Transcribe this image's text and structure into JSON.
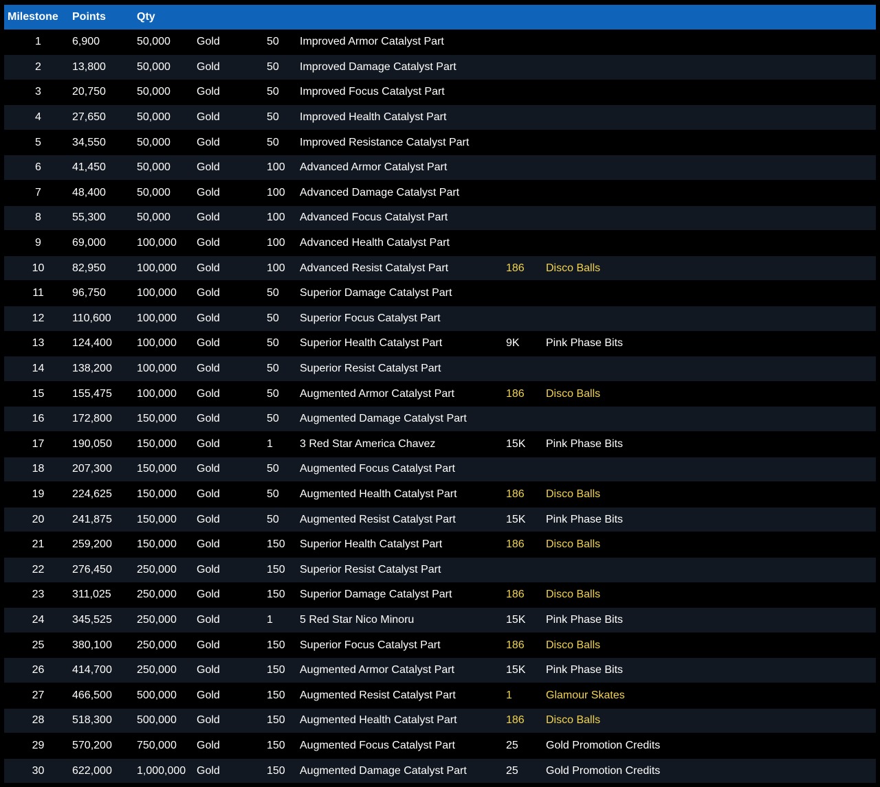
{
  "table": {
    "headers": [
      "Milestone",
      "Points",
      "Qty",
      "",
      "",
      "",
      "",
      ""
    ],
    "highlight_color": "#f2d44e",
    "header_color": "#0f63b8",
    "rows": [
      {
        "milestone": "1",
        "points": "6,900",
        "qty": "50,000",
        "currency": "Gold",
        "amount": "50",
        "reward": "Improved Armor Catalyst Part",
        "bonus_qty": "",
        "bonus_item": "",
        "highlight": false
      },
      {
        "milestone": "2",
        "points": "13,800",
        "qty": "50,000",
        "currency": "Gold",
        "amount": "50",
        "reward": "Improved Damage Catalyst Part",
        "bonus_qty": "",
        "bonus_item": "",
        "highlight": false
      },
      {
        "milestone": "3",
        "points": "20,750",
        "qty": "50,000",
        "currency": "Gold",
        "amount": "50",
        "reward": "Improved Focus Catalyst Part",
        "bonus_qty": "",
        "bonus_item": "",
        "highlight": false
      },
      {
        "milestone": "4",
        "points": "27,650",
        "qty": "50,000",
        "currency": "Gold",
        "amount": "50",
        "reward": "Improved Health Catalyst Part",
        "bonus_qty": "",
        "bonus_item": "",
        "highlight": false
      },
      {
        "milestone": "5",
        "points": "34,550",
        "qty": "50,000",
        "currency": "Gold",
        "amount": "50",
        "reward": "Improved Resistance Catalyst Part",
        "bonus_qty": "",
        "bonus_item": "",
        "highlight": false
      },
      {
        "milestone": "6",
        "points": "41,450",
        "qty": "50,000",
        "currency": "Gold",
        "amount": "100",
        "reward": "Advanced Armor Catalyst Part",
        "bonus_qty": "",
        "bonus_item": "",
        "highlight": false
      },
      {
        "milestone": "7",
        "points": "48,400",
        "qty": "50,000",
        "currency": "Gold",
        "amount": "100",
        "reward": "Advanced Damage Catalyst Part",
        "bonus_qty": "",
        "bonus_item": "",
        "highlight": false
      },
      {
        "milestone": "8",
        "points": "55,300",
        "qty": "50,000",
        "currency": "Gold",
        "amount": "100",
        "reward": "Advanced Focus Catalyst Part",
        "bonus_qty": "",
        "bonus_item": "",
        "highlight": false
      },
      {
        "milestone": "9",
        "points": "69,000",
        "qty": "100,000",
        "currency": "Gold",
        "amount": "100",
        "reward": "Advanced Health Catalyst Part",
        "bonus_qty": "",
        "bonus_item": "",
        "highlight": false
      },
      {
        "milestone": "10",
        "points": "82,950",
        "qty": "100,000",
        "currency": "Gold",
        "amount": "100",
        "reward": "Advanced Resist Catalyst Part",
        "bonus_qty": "186",
        "bonus_item": "Disco Balls",
        "highlight": true
      },
      {
        "milestone": "11",
        "points": "96,750",
        "qty": "100,000",
        "currency": "Gold",
        "amount": "50",
        "reward": "Superior Damage Catalyst Part",
        "bonus_qty": "",
        "bonus_item": "",
        "highlight": false
      },
      {
        "milestone": "12",
        "points": "110,600",
        "qty": "100,000",
        "currency": "Gold",
        "amount": "50",
        "reward": "Superior Focus Catalyst Part",
        "bonus_qty": "",
        "bonus_item": "",
        "highlight": false
      },
      {
        "milestone": "13",
        "points": "124,400",
        "qty": "100,000",
        "currency": "Gold",
        "amount": "50",
        "reward": "Superior Health Catalyst Part",
        "bonus_qty": "9K",
        "bonus_item": "Pink Phase Bits",
        "highlight": false
      },
      {
        "milestone": "14",
        "points": "138,200",
        "qty": "100,000",
        "currency": "Gold",
        "amount": "50",
        "reward": "Superior Resist Catalyst Part",
        "bonus_qty": "",
        "bonus_item": "",
        "highlight": false
      },
      {
        "milestone": "15",
        "points": "155,475",
        "qty": "100,000",
        "currency": "Gold",
        "amount": "50",
        "reward": "Augmented Armor Catalyst Part",
        "bonus_qty": "186",
        "bonus_item": "Disco Balls",
        "highlight": true
      },
      {
        "milestone": "16",
        "points": "172,800",
        "qty": "150,000",
        "currency": "Gold",
        "amount": "50",
        "reward": "Augmented Damage Catalyst Part",
        "bonus_qty": "",
        "bonus_item": "",
        "highlight": false
      },
      {
        "milestone": "17",
        "points": "190,050",
        "qty": "150,000",
        "currency": "Gold",
        "amount": "1",
        "reward": "3 Red Star America Chavez",
        "bonus_qty": "15K",
        "bonus_item": "Pink Phase Bits",
        "highlight": false
      },
      {
        "milestone": "18",
        "points": "207,300",
        "qty": "150,000",
        "currency": "Gold",
        "amount": "50",
        "reward": "Augmented Focus Catalyst Part",
        "bonus_qty": "",
        "bonus_item": "",
        "highlight": false
      },
      {
        "milestone": "19",
        "points": "224,625",
        "qty": "150,000",
        "currency": "Gold",
        "amount": "50",
        "reward": "Augmented Health Catalyst Part",
        "bonus_qty": "186",
        "bonus_item": "Disco Balls",
        "highlight": true
      },
      {
        "milestone": "20",
        "points": "241,875",
        "qty": "150,000",
        "currency": "Gold",
        "amount": "50",
        "reward": "Augmented Resist Catalyst Part",
        "bonus_qty": "15K",
        "bonus_item": "Pink Phase Bits",
        "highlight": false
      },
      {
        "milestone": "21",
        "points": "259,200",
        "qty": "150,000",
        "currency": "Gold",
        "amount": "150",
        "reward": "Superior Health Catalyst Part",
        "bonus_qty": "186",
        "bonus_item": "Disco Balls",
        "highlight": true
      },
      {
        "milestone": "22",
        "points": "276,450",
        "qty": "250,000",
        "currency": "Gold",
        "amount": "150",
        "reward": "Superior Resist Catalyst Part",
        "bonus_qty": "",
        "bonus_item": "",
        "highlight": false
      },
      {
        "milestone": "23",
        "points": "311,025",
        "qty": "250,000",
        "currency": "Gold",
        "amount": "150",
        "reward": "Superior Damage Catalyst Part",
        "bonus_qty": "186",
        "bonus_item": "Disco Balls",
        "highlight": true
      },
      {
        "milestone": "24",
        "points": "345,525",
        "qty": "250,000",
        "currency": "Gold",
        "amount": "1",
        "reward": "5 Red Star Nico Minoru",
        "bonus_qty": "15K",
        "bonus_item": "Pink Phase Bits",
        "highlight": false
      },
      {
        "milestone": "25",
        "points": "380,100",
        "qty": "250,000",
        "currency": "Gold",
        "amount": "150",
        "reward": "Superior Focus Catalyst Part",
        "bonus_qty": "186",
        "bonus_item": "Disco Balls",
        "highlight": true
      },
      {
        "milestone": "26",
        "points": "414,700",
        "qty": "250,000",
        "currency": "Gold",
        "amount": "150",
        "reward": "Augmented Armor Catalyst Part",
        "bonus_qty": "15K",
        "bonus_item": "Pink Phase Bits",
        "highlight": false
      },
      {
        "milestone": "27",
        "points": "466,500",
        "qty": "500,000",
        "currency": "Gold",
        "amount": "150",
        "reward": "Augmented Resist Catalyst Part",
        "bonus_qty": "1",
        "bonus_item": "Glamour Skates",
        "highlight": true
      },
      {
        "milestone": "28",
        "points": "518,300",
        "qty": "500,000",
        "currency": "Gold",
        "amount": "150",
        "reward": "Augmented Health Catalyst Part",
        "bonus_qty": "186",
        "bonus_item": "Disco Balls",
        "highlight": true
      },
      {
        "milestone": "29",
        "points": "570,200",
        "qty": "750,000",
        "currency": "Gold",
        "amount": "150",
        "reward": "Augmented Focus Catalyst Part",
        "bonus_qty": "25",
        "bonus_item": "Gold Promotion Credits",
        "highlight": false
      },
      {
        "milestone": "30",
        "points": "622,000",
        "qty": "1,000,000",
        "currency": "Gold",
        "amount": "150",
        "reward": "Augmented Damage Catalyst Part",
        "bonus_qty": "25",
        "bonus_item": "Gold Promotion Credits",
        "highlight": false
      }
    ]
  }
}
